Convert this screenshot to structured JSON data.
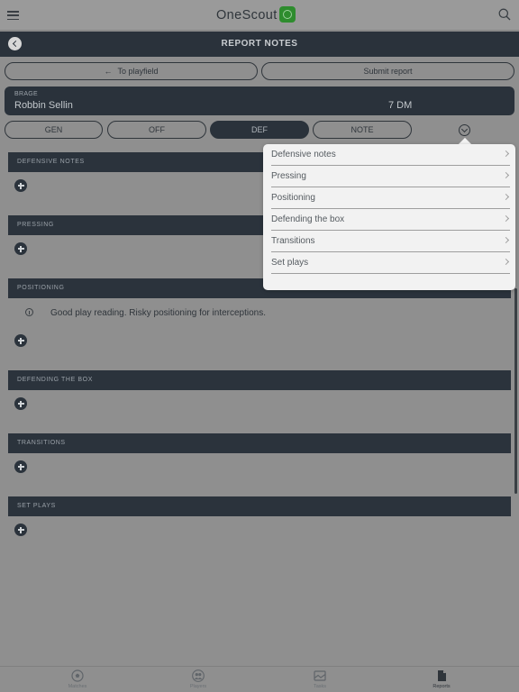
{
  "app": {
    "title": "OneScout"
  },
  "header": {
    "title": "REPORT NOTES"
  },
  "actions": {
    "to_playfield": "To playfield",
    "submit_report": "Submit report"
  },
  "player": {
    "team": "BRAGE",
    "name": "Robbin Sellin",
    "position": "7 DM"
  },
  "tabs": [
    {
      "label": "GEN",
      "active": false
    },
    {
      "label": "OFF",
      "active": false
    },
    {
      "label": "DEF",
      "active": true
    },
    {
      "label": "NOTE",
      "active": false
    }
  ],
  "sections": [
    {
      "title": "DEFENSIVE NOTES",
      "notes": []
    },
    {
      "title": "PRESSING",
      "notes": []
    },
    {
      "title": "POSITIONING",
      "notes": [
        "Good play reading. Risky positioning for interceptions."
      ]
    },
    {
      "title": "DEFENDING THE BOX",
      "notes": []
    },
    {
      "title": "TRANSITIONS",
      "notes": []
    },
    {
      "title": "SET PLAYS",
      "notes": []
    }
  ],
  "dropdown": {
    "items": [
      "Defensive notes",
      "Pressing",
      "Positioning",
      "Defending the box",
      "Transitions",
      "Set plays"
    ]
  },
  "bottom_nav": [
    {
      "label": "Matches",
      "icon": "soccer-ball-icon",
      "active": false
    },
    {
      "label": "Players",
      "icon": "players-icon",
      "active": false
    },
    {
      "label": "Tasks",
      "icon": "tasks-icon",
      "active": false
    },
    {
      "label": "Reports",
      "icon": "report-document-icon",
      "active": true
    }
  ],
  "colors": {
    "dark_navy": "#2a323b",
    "background_dimmed": "#8f8f8f",
    "brand_green": "#2e8c2e",
    "dropdown_bg": "#f2f2f2"
  }
}
